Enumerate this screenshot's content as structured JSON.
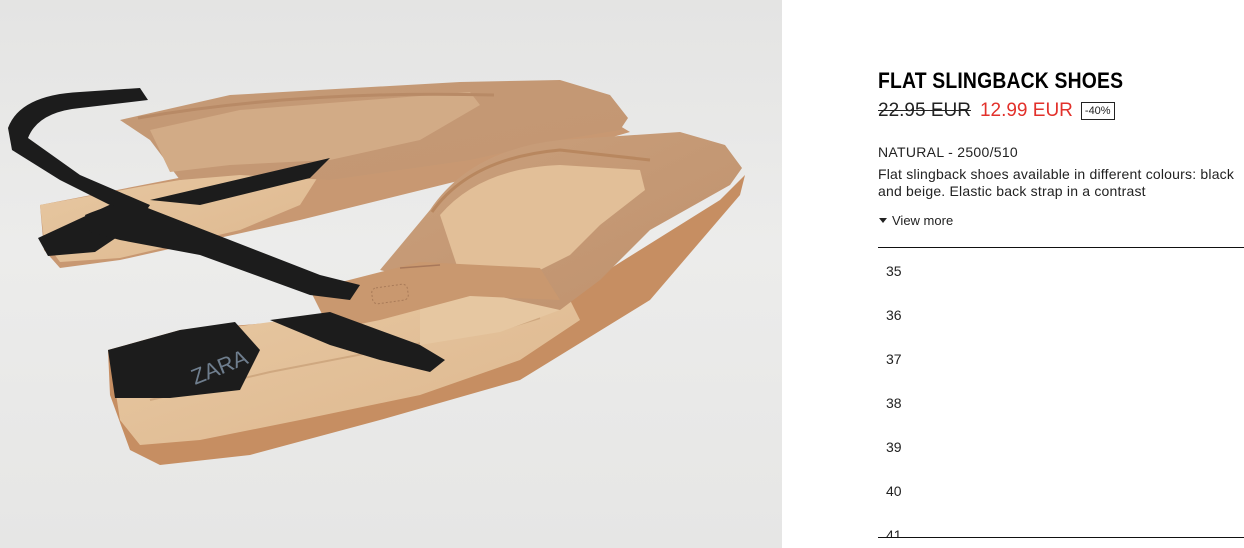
{
  "product": {
    "name": "FLAT SLINGBACK SHOES",
    "old_price": "22.95 EUR",
    "new_price": "12.99 EUR",
    "discount": "-40%",
    "color_ref": "NATURAL - 2500/510",
    "description": "Flat slingback shoes available in different colours: black and beige. Elastic back strap in a contrast",
    "view_more": "View more",
    "photo_logo": "ZARA"
  },
  "sizes": [
    "35",
    "36",
    "37",
    "38",
    "39",
    "40",
    "41"
  ],
  "colors": {
    "price_sale": "#e2312b",
    "leather": "#c9a07c",
    "sole": "#d9b08a",
    "strap": "#1c1c1c"
  }
}
